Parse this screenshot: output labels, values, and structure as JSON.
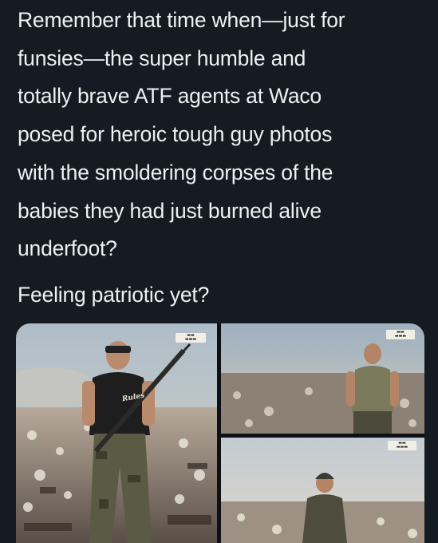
{
  "post": {
    "body_lines": [
      "Remember that time when—just for",
      "funsies—the super humble and",
      "totally brave ATF agents at Waco",
      "posed for heroic tough guy photos",
      "with the smoldering corpses of the",
      "babies they had just burned alive",
      "underfoot?"
    ],
    "closing": "Feeling patriotic yet?"
  },
  "media": {
    "photos": [
      {
        "subject": "agent-with-rifle-photo",
        "shirt_text": "Rules"
      },
      {
        "subject": "agent-in-tshirt-photo"
      },
      {
        "subject": "agent-in-helmet-photo"
      }
    ]
  },
  "colors": {
    "background": "#151b22",
    "text": "#eef1f4"
  }
}
